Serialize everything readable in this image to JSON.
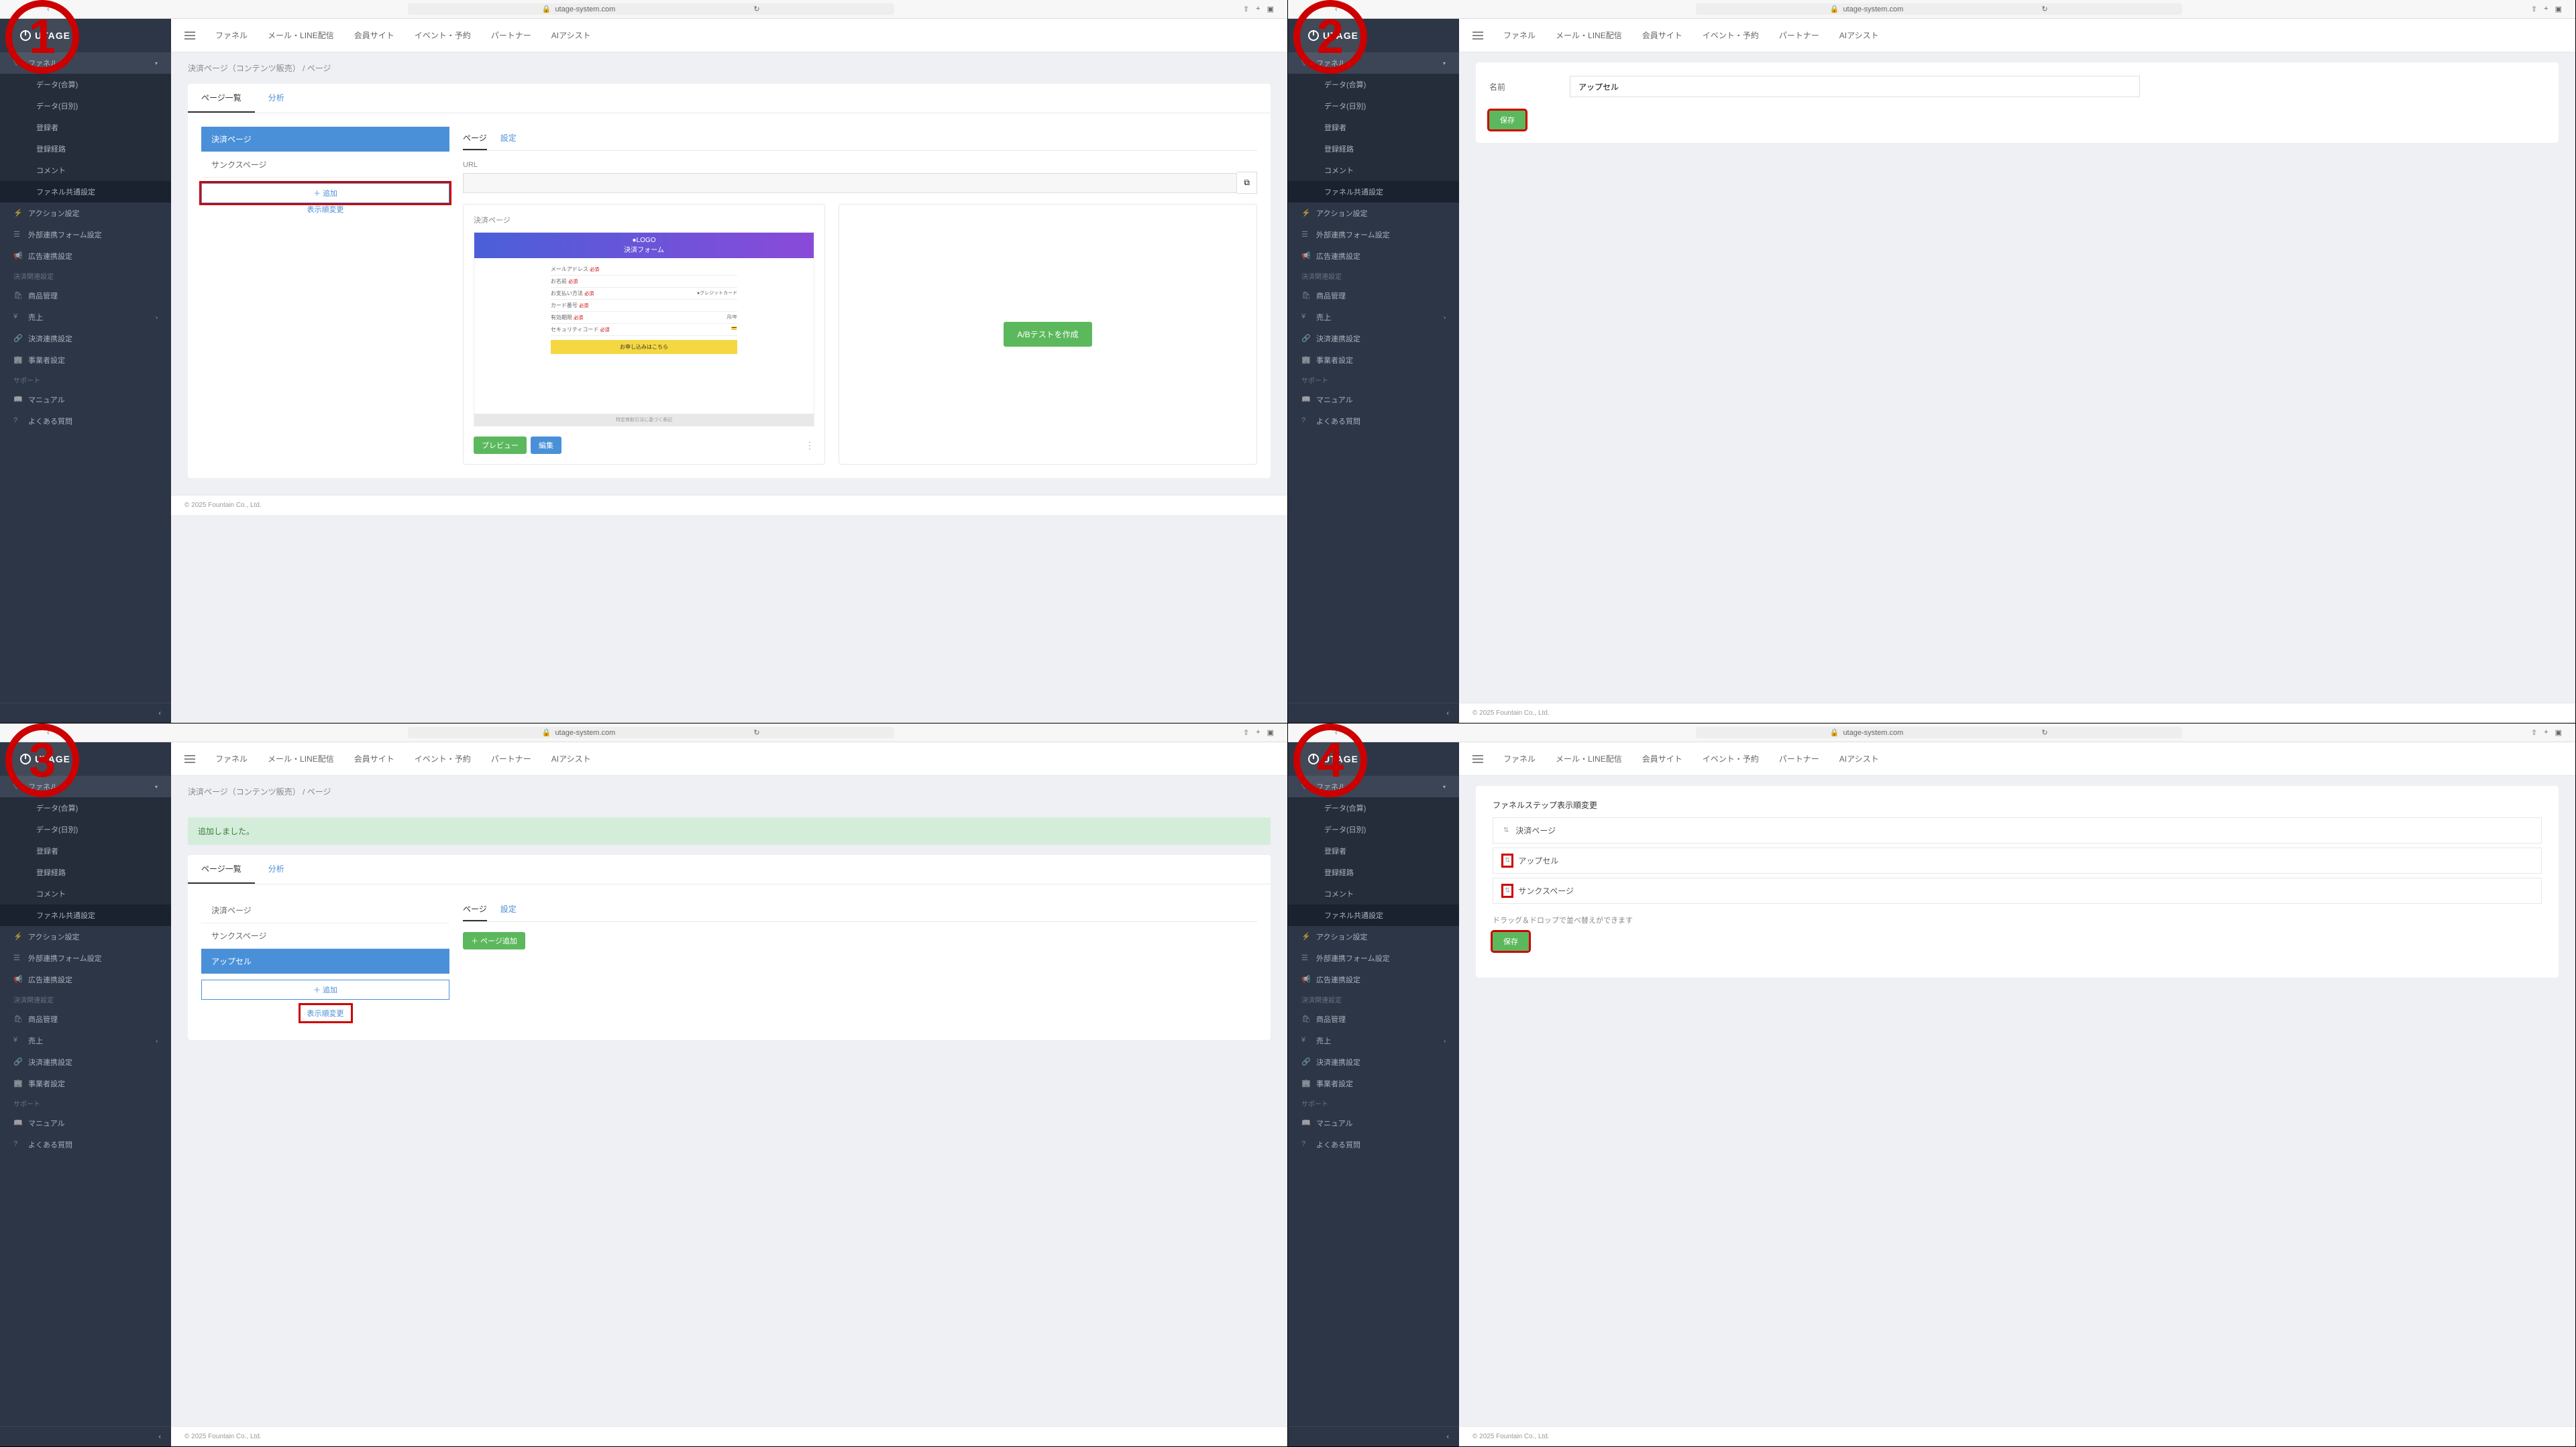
{
  "url": "utage-system.com",
  "logo": "UTAGE",
  "topnav": [
    "ファネル",
    "メール・LINE配信",
    "会員サイト",
    "イベント・予約",
    "パートナー",
    "AIアシスト"
  ],
  "sidebar": {
    "top_item": "ファネル",
    "funnel_name": "ファネル",
    "sub_items": [
      "データ(合算)",
      "データ(日別)",
      "登録者",
      "登録経路",
      "コメント",
      "ファネル共通設定"
    ],
    "mid_items": [
      "アクション設定",
      "外部連携フォーム設定",
      "広告連携設定"
    ],
    "section1": "決済関連設定",
    "sec1_items": [
      "商品管理",
      "売上",
      "決済連携設定",
      "事業者設定"
    ],
    "section2": "サポート",
    "sec2_items": [
      "マニュアル",
      "よくある質問"
    ]
  },
  "breadcrumb": {
    "a": "決済ページ（コンテンツ販売）",
    "sep": "/",
    "b": "ページ"
  },
  "s1": {
    "tabs": [
      "ページ一覧",
      "分析"
    ],
    "pages": [
      "決済ページ",
      "サンクスページ"
    ],
    "add": "＋ 追加",
    "order": "表示順変更",
    "right_tabs": [
      "ページ",
      "設定"
    ],
    "url_label": "URL",
    "url_placeholder": "",
    "preview_label": "決済ページ",
    "pc_logo": "●LOGO",
    "pc_title": "決済フォーム",
    "btn_preview": "プレビュー",
    "btn_edit": "編集",
    "btn_ab": "A/Bテストを作成"
  },
  "s2": {
    "label": "名前",
    "value": "アップセル",
    "save": "保存"
  },
  "s3": {
    "flash": "追加しました。",
    "tabs": [
      "ページ一覧",
      "分析"
    ],
    "pages": [
      "決済ページ",
      "サンクスページ",
      "アップセル"
    ],
    "add": "＋ 追加",
    "order": "表示順変更",
    "right_tabs": [
      "ページ",
      "設定"
    ],
    "btn_add_page": "＋ ページ追加"
  },
  "s4": {
    "title": "ファネルステップ表示順変更",
    "items": [
      "決済ページ",
      "アップセル",
      "サンクスページ"
    ],
    "help": "ドラッグ＆ドロップで並べ替えができます",
    "save": "保存"
  },
  "footer": "© 2025 Fountain Co., Ltd."
}
